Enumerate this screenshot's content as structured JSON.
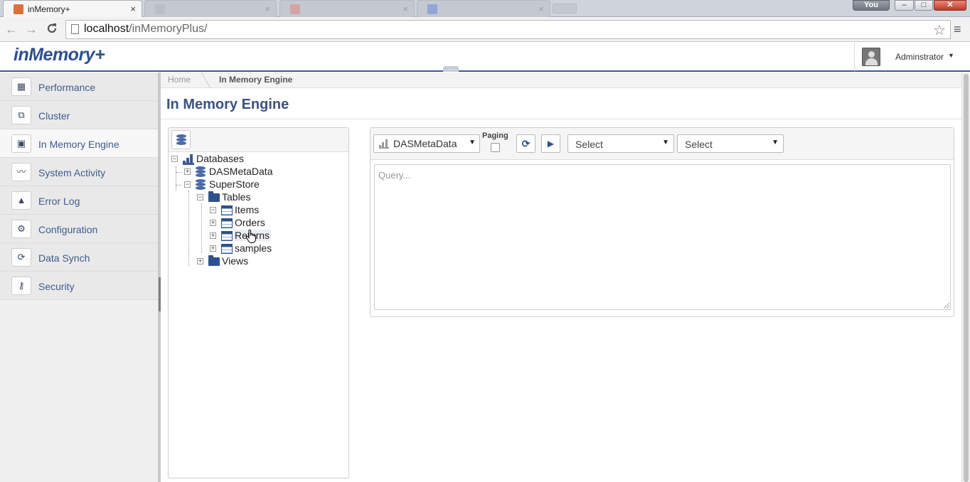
{
  "browser": {
    "active_tab": "inMemory+",
    "inactive_tabs": [
      "",
      "",
      ""
    ],
    "tab_close": "×",
    "profile": "You",
    "window_buttons": {
      "minimize": "–",
      "maximize": "□",
      "close": "✕"
    },
    "url_host": "localhost",
    "url_path": "/inMemoryPlus/",
    "nav": {
      "back": "←",
      "forward": "→",
      "reload": "C",
      "star": "☆",
      "menu": "≡"
    }
  },
  "app": {
    "logo": "inMemory+",
    "user": "Adminstrator",
    "user_caret": "▼",
    "handle": "....",
    "accent_color": "#3b5998"
  },
  "sidebar": {
    "items": [
      {
        "label": "Performance",
        "icon": "performance-icon",
        "glyph": "▦",
        "active": false
      },
      {
        "label": "Cluster",
        "icon": "cluster-icon",
        "glyph": "⧉",
        "active": false
      },
      {
        "label": "In Memory Engine",
        "icon": "memory-chip-icon",
        "glyph": "▣",
        "active": true
      },
      {
        "label": "System Activity",
        "icon": "activity-icon",
        "glyph": "〰",
        "active": false
      },
      {
        "label": "Error Log",
        "icon": "warning-icon",
        "glyph": "▲",
        "active": false
      },
      {
        "label": "Configuration",
        "icon": "gear-icon",
        "glyph": "⚙",
        "active": false
      },
      {
        "label": "Data Synch",
        "icon": "sync-icon",
        "glyph": "⟳",
        "active": false
      },
      {
        "label": "Security",
        "icon": "key-icon",
        "glyph": "⚷",
        "active": false
      }
    ]
  },
  "breadcrumb": {
    "home": "Home",
    "current": "In Memory Engine"
  },
  "page": {
    "title": "In Memory Engine"
  },
  "tree": {
    "expander_open": "−",
    "expander_closed": "+",
    "root": "Databases",
    "db1": "DASMetaData",
    "db2": "SuperStore",
    "tables": "Tables",
    "table_items": [
      "Items",
      "Orders",
      "Returns",
      "samples"
    ],
    "views": "Views"
  },
  "query": {
    "database": "DASMetaData",
    "paging_label": "Paging",
    "paging_checked": false,
    "refresh": "⟳",
    "run": "▶",
    "select1": "Select",
    "select2": "Select",
    "dropdown_arrow": "▼",
    "placeholder": "Query..."
  }
}
